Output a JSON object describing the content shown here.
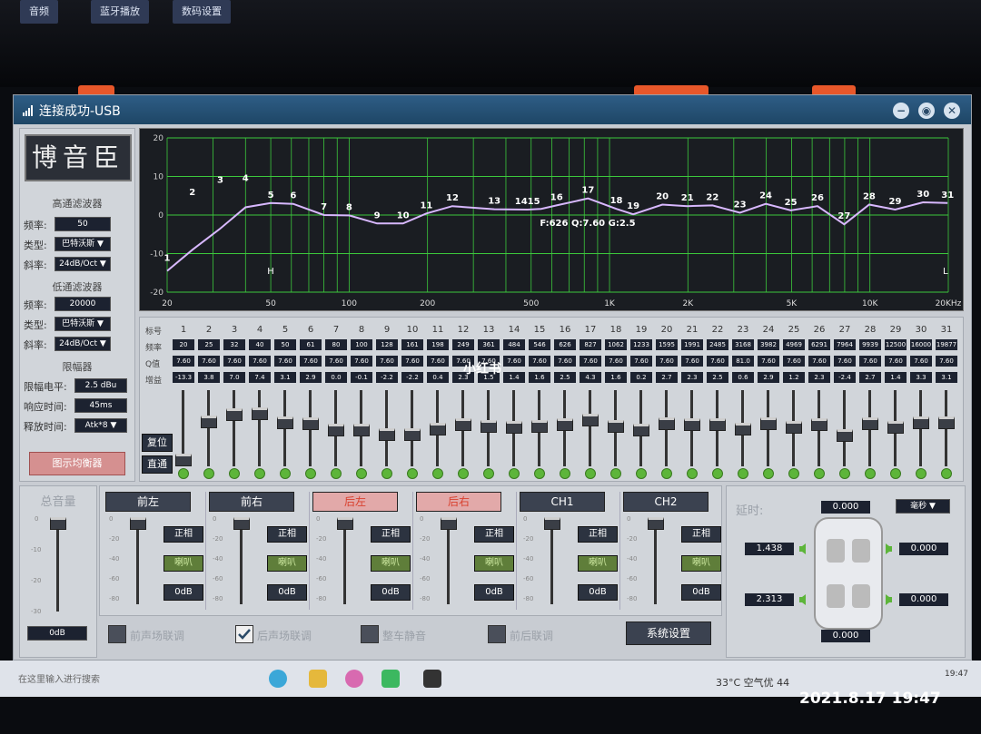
{
  "desktop": {
    "icons": [
      "音频",
      "蓝牙播放",
      "数码设置"
    ]
  },
  "window": {
    "title": "连接成功-USB",
    "minimize": "−",
    "restore": "◉",
    "close": "✕"
  },
  "left": {
    "logo": "博音臣",
    "hpf": {
      "title": "高通滤波器",
      "freq_label": "频率:",
      "freq": "50",
      "type_label": "类型:",
      "type": "巴特沃斯 ▼",
      "slope_label": "斜率:",
      "slope": "24dB/Oct ▼"
    },
    "lpf": {
      "title": "低通滤波器",
      "freq_label": "频率:",
      "freq": "20000",
      "type_label": "类型:",
      "type": "巴特沃斯 ▼",
      "slope_label": "斜率:",
      "slope": "24dB/Oct ▼"
    },
    "limiter": {
      "title": "限幅器",
      "level_label": "限幅电平:",
      "level": "2.5 dBu",
      "attack_label": "响应时间:",
      "attack": "45ms",
      "release_label": "释放时间:",
      "release": "Atk*8 ▼"
    },
    "show_eq_button": "图示均衡器"
  },
  "graph": {
    "y_ticks": [
      "20",
      "10",
      "0",
      "-10",
      "-20"
    ],
    "x_ticks": [
      "20",
      "50",
      "100",
      "200",
      "500",
      "1K",
      "2K",
      "5K",
      "10K",
      "20KHz"
    ],
    "point_labels": [
      "1",
      "2",
      "3",
      "4",
      "5",
      "6",
      "7",
      "8",
      "9",
      "10",
      "11",
      "12",
      "13",
      "1415",
      "16",
      "17",
      "18",
      "19",
      "20",
      "21",
      "22",
      "23",
      "24",
      "25",
      "26",
      "27",
      "28",
      "29",
      "30",
      "31"
    ],
    "hpf_marker": "H",
    "lpf_marker": "L",
    "readout": "F:626 Q:7.60 G:2.5"
  },
  "eq": {
    "row_labels": [
      "标号",
      "频率",
      "Q值",
      "增益"
    ],
    "bands": [
      {
        "n": "1",
        "f": "20",
        "q": "7.60",
        "g": "-13.3",
        "level": -13.3
      },
      {
        "n": "2",
        "f": "25",
        "q": "7.60",
        "g": "3.8",
        "level": 3.8
      },
      {
        "n": "3",
        "f": "32",
        "q": "7.60",
        "g": "7.0",
        "level": 7.0
      },
      {
        "n": "4",
        "f": "40",
        "q": "7.60",
        "g": "7.4",
        "level": 7.4
      },
      {
        "n": "5",
        "f": "50",
        "q": "7.60",
        "g": "3.1",
        "level": 3.1
      },
      {
        "n": "6",
        "f": "61",
        "q": "7.60",
        "g": "2.9",
        "level": 2.9
      },
      {
        "n": "7",
        "f": "80",
        "q": "7.60",
        "g": "0.0",
        "level": 0.0
      },
      {
        "n": "8",
        "f": "100",
        "q": "7.60",
        "g": "-0.1",
        "level": -0.1
      },
      {
        "n": "9",
        "f": "128",
        "q": "7.60",
        "g": "-2.2",
        "level": -2.2
      },
      {
        "n": "10",
        "f": "161",
        "q": "7.60",
        "g": "-2.2",
        "level": -2.2
      },
      {
        "n": "11",
        "f": "198",
        "q": "7.60",
        "g": "0.4",
        "level": 0.4
      },
      {
        "n": "12",
        "f": "249",
        "q": "7.60",
        "g": "2.3",
        "level": 2.3
      },
      {
        "n": "13",
        "f": "361",
        "q": "7.60",
        "g": "1.5",
        "level": 1.5
      },
      {
        "n": "14",
        "f": "484",
        "q": "7.60",
        "g": "1.4",
        "level": 1.4
      },
      {
        "n": "15",
        "f": "546",
        "q": "7.60",
        "g": "1.6",
        "level": 1.6
      },
      {
        "n": "16",
        "f": "626",
        "q": "7.60",
        "g": "2.5",
        "level": 2.5
      },
      {
        "n": "17",
        "f": "827",
        "q": "7.60",
        "g": "4.3",
        "level": 4.3
      },
      {
        "n": "18",
        "f": "1062",
        "q": "7.60",
        "g": "1.6",
        "level": 1.6
      },
      {
        "n": "19",
        "f": "1233",
        "q": "7.60",
        "g": "0.2",
        "level": 0.2
      },
      {
        "n": "20",
        "f": "1595",
        "q": "7.60",
        "g": "2.7",
        "level": 2.7
      },
      {
        "n": "21",
        "f": "1991",
        "q": "7.60",
        "g": "2.3",
        "level": 2.3
      },
      {
        "n": "22",
        "f": "2485",
        "q": "7.60",
        "g": "2.5",
        "level": 2.5
      },
      {
        "n": "23",
        "f": "3168",
        "q": "81.0",
        "g": "0.6",
        "level": 0.6
      },
      {
        "n": "24",
        "f": "3982",
        "q": "7.60",
        "g": "2.9",
        "level": 2.9
      },
      {
        "n": "25",
        "f": "4969",
        "q": "7.60",
        "g": "1.2",
        "level": 1.2
      },
      {
        "n": "26",
        "f": "6291",
        "q": "7.60",
        "g": "2.3",
        "level": 2.3
      },
      {
        "n": "27",
        "f": "7964",
        "q": "7.60",
        "g": "-2.4",
        "level": -2.4
      },
      {
        "n": "28",
        "f": "9939",
        "q": "7.60",
        "g": "2.7",
        "level": 2.7
      },
      {
        "n": "29",
        "f": "12500",
        "q": "7.60",
        "g": "1.4",
        "level": 1.4
      },
      {
        "n": "30",
        "f": "16000",
        "q": "7.60",
        "g": "3.3",
        "level": 3.3
      },
      {
        "n": "31",
        "f": "19877",
        "q": "7.60",
        "g": "3.1",
        "level": 3.1
      }
    ],
    "reset_button": "复位",
    "bypass_button": "直通"
  },
  "master": {
    "title": "总音量",
    "value": "0dB",
    "level": 1.0,
    "scale": [
      "0",
      "-10",
      "-20",
      "-30"
    ]
  },
  "channels": [
    {
      "name": "前左",
      "phase": "正相",
      "mute": "喇叭",
      "gain": "0dB",
      "muted": false,
      "level": 1.0
    },
    {
      "name": "前右",
      "phase": "正相",
      "mute": "喇叭",
      "gain": "0dB",
      "muted": false,
      "level": 1.0
    },
    {
      "name": "后左",
      "phase": "正相",
      "mute": "喇叭",
      "gain": "0dB",
      "muted": true,
      "level": 1.0
    },
    {
      "name": "后右",
      "phase": "正相",
      "mute": "喇叭",
      "gain": "0dB",
      "muted": true,
      "level": 1.0
    },
    {
      "name": "CH1",
      "phase": "正相",
      "mute": "喇叭",
      "gain": "0dB",
      "muted": false,
      "level": 1.0
    },
    {
      "name": "CH2",
      "phase": "正相",
      "mute": "喇叭",
      "gain": "0dB",
      "muted": false,
      "level": 1.0
    }
  ],
  "channel_scale": [
    "0",
    "-20",
    "-40",
    "-60",
    "-80"
  ],
  "checkboxes": [
    {
      "label": "前声场联调",
      "checked": false
    },
    {
      "label": "后声场联调",
      "checked": true
    },
    {
      "label": "整车静音",
      "checked": false
    },
    {
      "label": "前后联调",
      "checked": false
    }
  ],
  "system_button": "系统设置",
  "delay": {
    "label": "延时:",
    "unit": "毫秒 ▼",
    "top": "0.000",
    "fl": "1.438",
    "fr": "0.000",
    "rl": "2.313",
    "rr": "0.000",
    "bottom": "0.000"
  },
  "taskbar": {
    "search": "在这里输入进行搜索",
    "status": "33°C  空气优 44",
    "time": "19:47"
  },
  "photo": {
    "timestamp": "2021.8.17  19:47",
    "watermark": "小红书"
  },
  "colors": {
    "grid": "#3cc83c",
    "curve": "#d8b8ff",
    "bg": "#1a1d22",
    "accent": "#2e5d86",
    "muted": "#e2a9a9"
  }
}
